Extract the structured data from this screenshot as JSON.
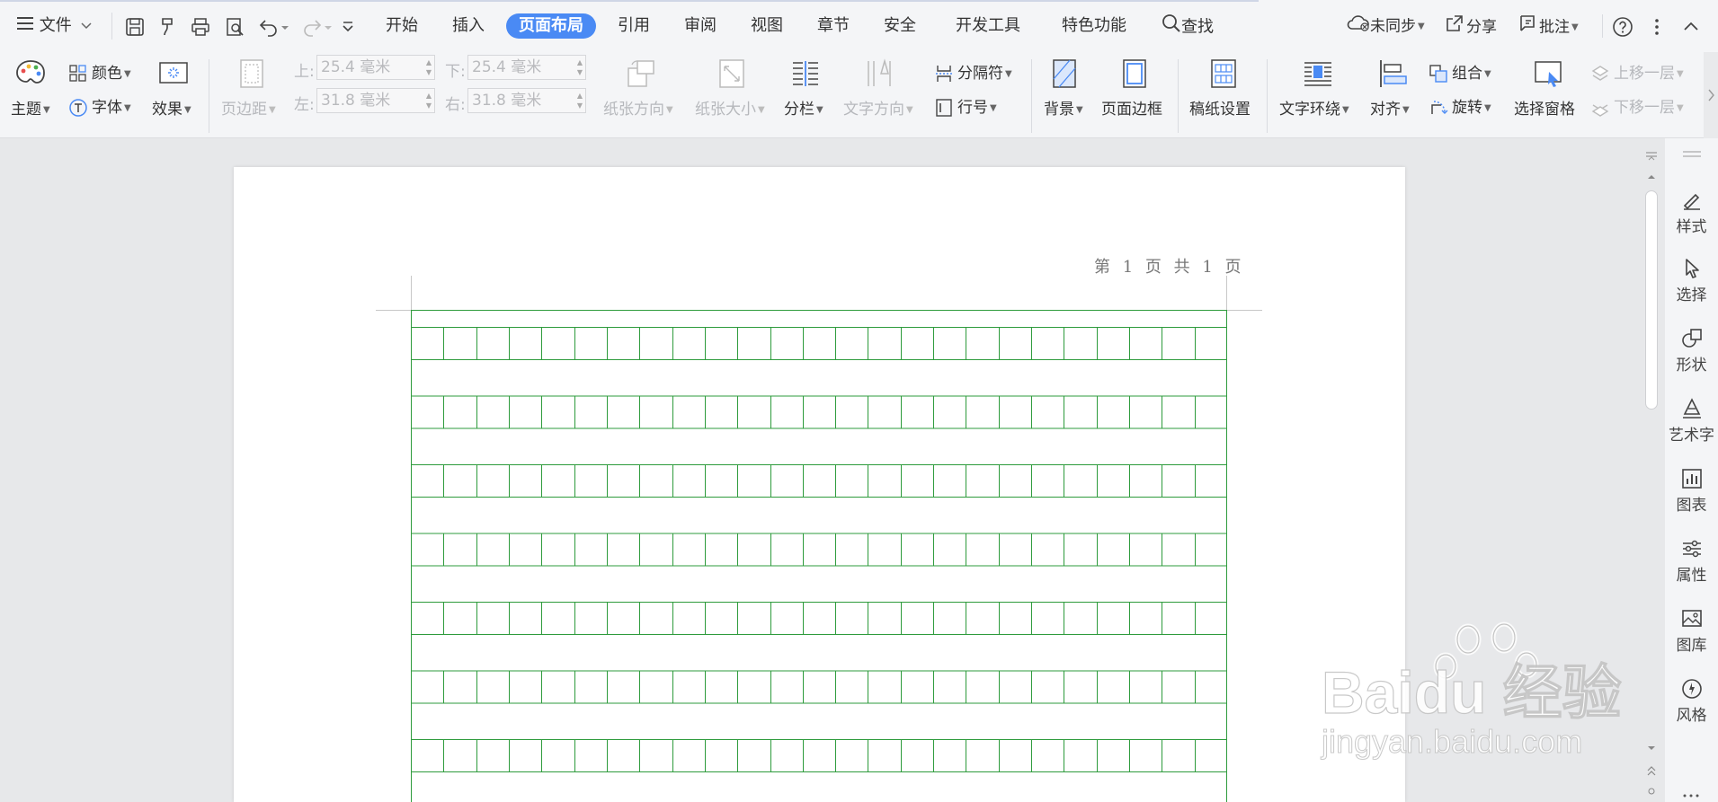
{
  "menubar": {
    "file_label": "文件",
    "tabs": [
      {
        "label": "开始"
      },
      {
        "label": "插入"
      },
      {
        "label": "页面布局"
      },
      {
        "label": "引用"
      },
      {
        "label": "审阅"
      },
      {
        "label": "视图"
      },
      {
        "label": "章节"
      },
      {
        "label": "安全"
      },
      {
        "label": "开发工具"
      },
      {
        "label": "特色功能"
      }
    ],
    "search_label": "查找",
    "sync_label": "未同步",
    "share_label": "分享",
    "comment_label": "批注"
  },
  "ribbon": {
    "theme_label": "主题",
    "color_label": "颜色",
    "font_label": "字体",
    "effect_label": "效果",
    "margin_label": "页边距",
    "top_label": "上:",
    "top_value": "25.4 毫米",
    "bottom_label": "下:",
    "bottom_value": "25.4 毫米",
    "left_label": "左:",
    "left_value": "31.8 毫米",
    "right_label": "右:",
    "right_value": "31.8 毫米",
    "orientation_label": "纸张方向",
    "size_label": "纸张大小",
    "columns_label": "分栏",
    "text_direction_label": "文字方向",
    "breaks_label": "分隔符",
    "line_numbers_label": "行号",
    "background_label": "背景",
    "page_border_label": "页面边框",
    "manuscript_label": "稿纸设置",
    "wrap_label": "文字环绕",
    "align_label": "对齐",
    "group_label": "组合",
    "rotate_label": "旋转",
    "selection_pane_label": "选择窗格",
    "bring_forward_label": "上移一层",
    "send_backward_label": "下移一层"
  },
  "document": {
    "page_header": "第 1 页 共 1 页"
  },
  "sidepanel": {
    "items": [
      {
        "label": "样式"
      },
      {
        "label": "选择"
      },
      {
        "label": "形状"
      },
      {
        "label": "艺术字"
      },
      {
        "label": "图表"
      },
      {
        "label": "属性"
      },
      {
        "label": "图库"
      },
      {
        "label": "风格"
      }
    ]
  },
  "watermark": {
    "brand": "Baidu 经验",
    "url": "jingyan.baidu.com"
  },
  "colors": {
    "accent": "#4a8af4",
    "grid_green": "#2e9b3c",
    "disabled_text": "#b6b8bc"
  }
}
